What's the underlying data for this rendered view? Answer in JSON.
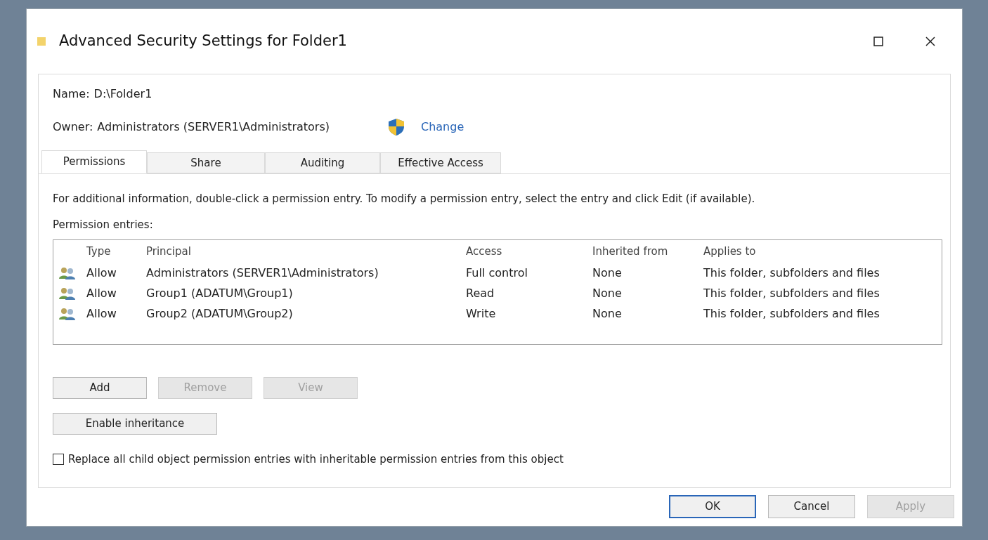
{
  "window": {
    "title": "Advanced Security Settings for Folder1"
  },
  "name": {
    "label": "Name:",
    "value": "D:\\Folder1"
  },
  "owner": {
    "label": "Owner:",
    "value": "Administrators (SERVER1\\Administrators)",
    "change_link": "Change"
  },
  "tabs": [
    {
      "label": "Permissions",
      "selected": true
    },
    {
      "label": "Share",
      "selected": false
    },
    {
      "label": "Auditing",
      "selected": false
    },
    {
      "label": "Effective Access",
      "selected": false
    }
  ],
  "info_text": "For additional information, double-click a permission entry. To modify a permission entry, select the entry and click Edit (if available).",
  "entries_label": "Permission entries:",
  "table": {
    "columns": [
      "Type",
      "Principal",
      "Access",
      "Inherited from",
      "Applies to"
    ],
    "rows": [
      {
        "type": "Allow",
        "principal": "Administrators (SERVER1\\Administrators)",
        "access": "Full control",
        "inherited_from": "None",
        "applies_to": "This folder, subfolders and files"
      },
      {
        "type": "Allow",
        "principal": "Group1 (ADATUM\\Group1)",
        "access": "Read",
        "inherited_from": "None",
        "applies_to": "This folder, subfolders and files"
      },
      {
        "type": "Allow",
        "principal": "Group2 (ADATUM\\Group2)",
        "access": "Write",
        "inherited_from": "None",
        "applies_to": "This folder, subfolders and files"
      }
    ]
  },
  "entry_buttons": [
    {
      "label": "Add",
      "disabled": false
    },
    {
      "label": "Remove",
      "disabled": true
    },
    {
      "label": "View",
      "disabled": true
    }
  ],
  "inheritance_button": {
    "label": "Enable inheritance",
    "disabled": false
  },
  "replace_checkbox": {
    "label": "Replace all child object permission entries with inheritable permission entries from this object",
    "checked": false
  },
  "dialog_buttons": [
    {
      "label": "OK",
      "disabled": false,
      "default": true
    },
    {
      "label": "Cancel",
      "disabled": false,
      "default": false
    },
    {
      "label": "Apply",
      "disabled": true,
      "default": false
    }
  ]
}
